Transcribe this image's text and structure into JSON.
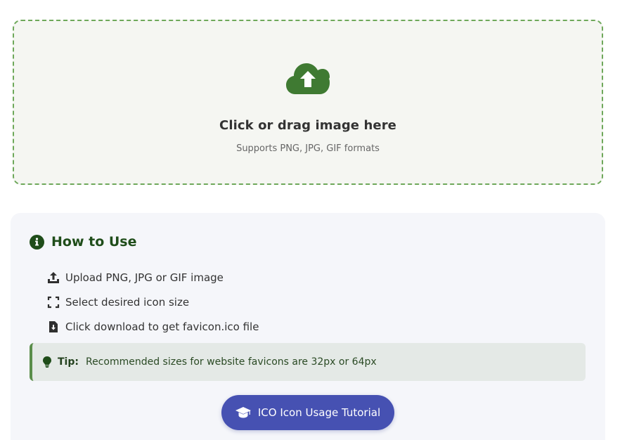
{
  "upload": {
    "title": "Click or drag image here",
    "subtitle": "Supports PNG, JPG, GIF formats",
    "icon": "cloud-upload-icon"
  },
  "howto": {
    "title": "How to Use",
    "icon": "info-circle-icon",
    "steps": [
      {
        "icon": "upload-icon",
        "text": "Upload PNG, JPG or GIF image"
      },
      {
        "icon": "expand-icon",
        "text": "Select desired icon size"
      },
      {
        "icon": "file-download-icon",
        "text": "Click download to get favicon.ico file"
      }
    ],
    "tip": {
      "icon": "lightbulb-icon",
      "label": "Tip:",
      "text": "Recommended sizes for website favicons are 32px or 64px"
    },
    "tutorial_button": {
      "icon": "graduation-cap-icon",
      "label": "ICO Icon Usage Tutorial"
    }
  },
  "colors": {
    "accent_green": "#3f7a32",
    "dashed_border": "#6ea85a",
    "heading_green": "#1f4d1a",
    "button_blue": "#4651b2",
    "tip_bg": "#e4e9e6"
  }
}
